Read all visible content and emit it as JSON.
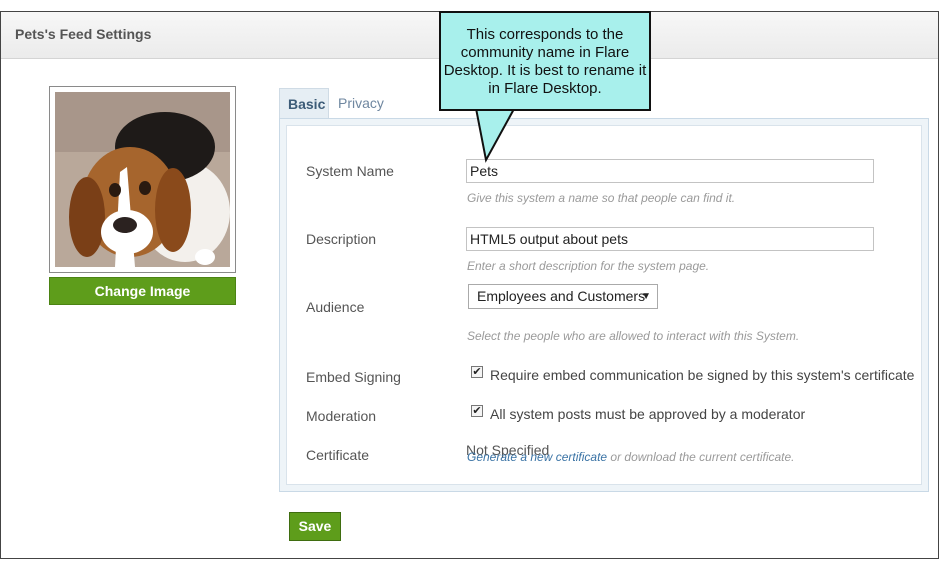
{
  "header": {
    "title": "Pets's Feed Settings"
  },
  "photo": {
    "change_label": "Change Image"
  },
  "tabs": [
    {
      "label": "Basic",
      "active": true
    },
    {
      "label": "Privacy",
      "active": false
    }
  ],
  "form": {
    "system_name": {
      "label": "System Name",
      "value": "Pets",
      "hint": "Give this system a name so that people can find it."
    },
    "description": {
      "label": "Description",
      "value": "HTML5 output about pets",
      "hint": "Enter a short description for the system page."
    },
    "audience": {
      "label": "Audience",
      "selected": "Employees and Customers",
      "hint": "Select the people who are allowed to interact with this System."
    },
    "embed_signing": {
      "label": "Embed Signing",
      "checked": true,
      "text": "Require embed communication be signed by this system's certificate"
    },
    "moderation": {
      "label": "Moderation",
      "checked": true,
      "text": "All system posts must be approved by a moderator"
    },
    "certificate": {
      "label": "Certificate",
      "value": "Not Specified",
      "link_text": "Generate a new certificate",
      "suffix": " or download the current certificate."
    }
  },
  "save_label": "Save",
  "callout": {
    "text": "This corresponds to the community name in Flare Desktop. It is best to rename it in Flare Desktop."
  },
  "colors": {
    "accent_green": "#5e9d1b",
    "callout_bg": "#a8f0ec",
    "link": "#3a73a5"
  }
}
